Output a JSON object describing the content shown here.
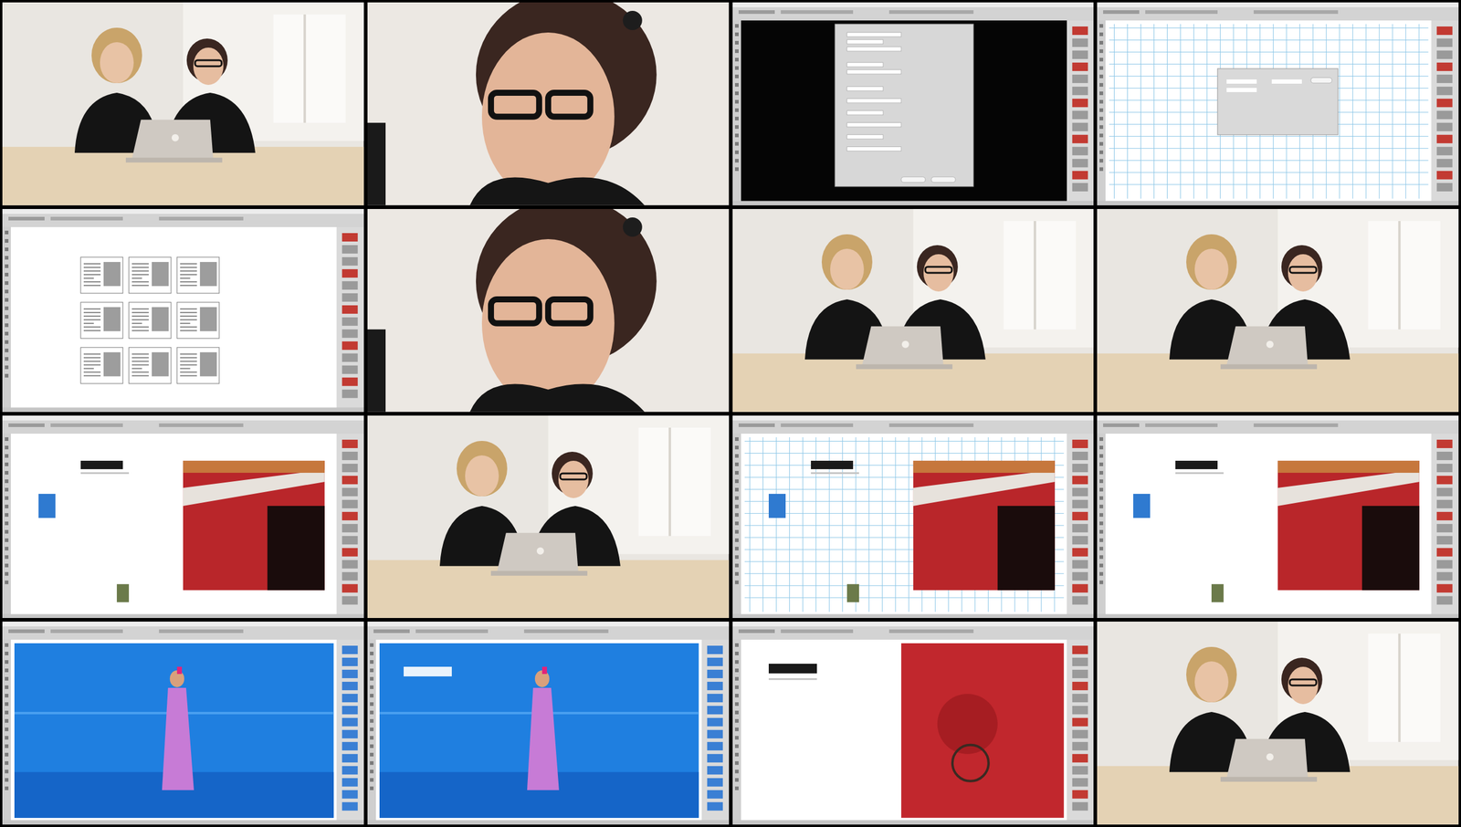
{
  "frames": [
    {
      "kind": "wide-shot",
      "variant": "plain"
    },
    {
      "kind": "close-up",
      "variant": "plain"
    },
    {
      "kind": "screen",
      "variant": "dialog"
    },
    {
      "kind": "screen",
      "variant": "guides"
    },
    {
      "kind": "screen",
      "variant": "thumbnails"
    },
    {
      "kind": "close-up",
      "variant": "plain"
    },
    {
      "kind": "wide-shot",
      "variant": "plain"
    },
    {
      "kind": "wide-shot",
      "variant": "plain"
    },
    {
      "kind": "screen",
      "variant": "spread"
    },
    {
      "kind": "wide-shot",
      "variant": "plain"
    },
    {
      "kind": "screen",
      "variant": "spread-grid"
    },
    {
      "kind": "screen",
      "variant": "spread"
    },
    {
      "kind": "screen",
      "variant": "blue"
    },
    {
      "kind": "screen",
      "variant": "blue-text"
    },
    {
      "kind": "screen",
      "variant": "door"
    },
    {
      "kind": "wide-shot",
      "variant": "plain"
    }
  ]
}
